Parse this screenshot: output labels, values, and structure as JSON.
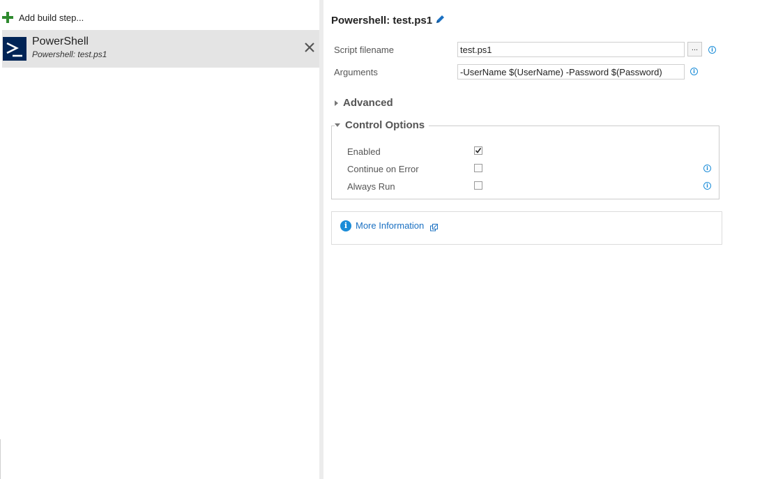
{
  "left_panel": {
    "add_step_label": "Add build step...",
    "task": {
      "title": "PowerShell",
      "subtitle": "Powershell: test.ps1",
      "icon": "powershell-icon"
    }
  },
  "details": {
    "title": "Powershell: test.ps1",
    "fields": {
      "script_filename": {
        "label": "Script filename",
        "value": "test.ps1",
        "browse_label": "..."
      },
      "arguments": {
        "label": "Arguments",
        "value": "-UserName $(UserName) -Password $(Password)"
      }
    },
    "sections": {
      "advanced": "Advanced",
      "control_options": "Control Options"
    },
    "control_options": {
      "enabled": {
        "label": "Enabled",
        "checked": true
      },
      "continue_on_error": {
        "label": "Continue on Error",
        "checked": false
      },
      "always_run": {
        "label": "Always Run",
        "checked": false
      }
    },
    "more_information": "More Information"
  },
  "colors": {
    "accent": "#1a8cd8",
    "add_green": "#2e8a2e",
    "powershell_blue": "#012456",
    "selected_bg": "#e4e4e4"
  }
}
